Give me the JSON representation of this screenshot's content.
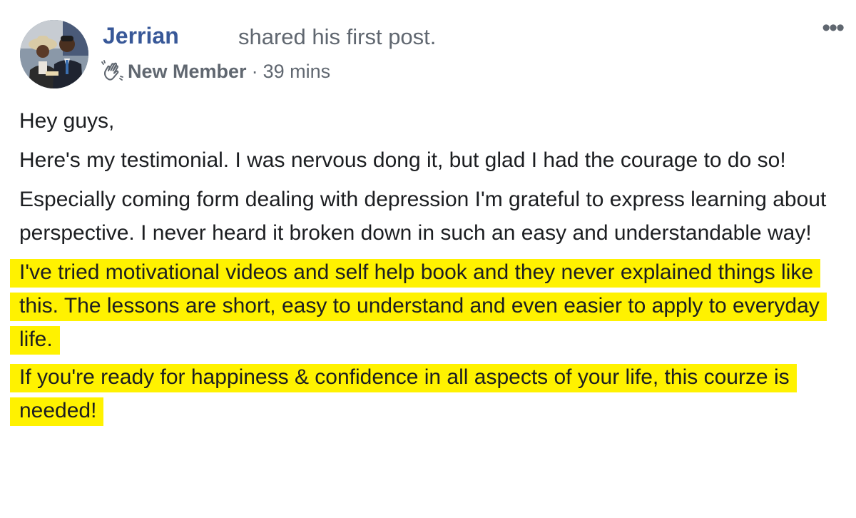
{
  "post": {
    "author": "Jerrian",
    "action": "shared his first post.",
    "badge": {
      "icon": "waving-hand-icon",
      "label": "New Member"
    },
    "separator": "·",
    "timestamp": "39 mins",
    "paragraphs": [
      "Hey guys,",
      "Here's my testimonial. I was nervous dong it, but glad I had the courage to do so!",
      "Especially coming form dealing with depression I'm grateful to express learning about perspective. I never heard it broken down in such an easy and understandable way!"
    ],
    "highlighted_paragraphs": [
      "I've tried motivational videos and self help book and they never explained things like this. The lessons are short, easy to understand and even easier to apply to everyday life.",
      "If you're ready for happiness & confidence in all aspects of your life, this courze is needed!"
    ],
    "highlight_color": "#fff200",
    "author_color": "#385898",
    "more_button": "•••"
  }
}
